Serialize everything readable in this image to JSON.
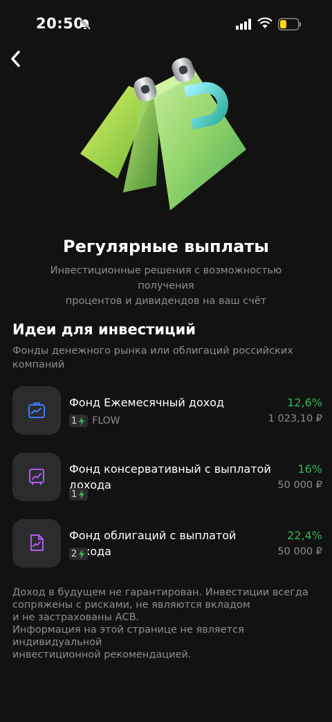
{
  "status_bar": {
    "time": "20:50"
  },
  "hero": {
    "icon": "ruble-calendar-illustration",
    "currency_symbol": "₽"
  },
  "header": {
    "title": "Регулярные выплаты",
    "subtitle_line1": "Инвестиционные решения с возможностью получения",
    "subtitle_line2": "процентов и дивидендов на ваш счёт"
  },
  "ideas": {
    "title": "Идеи для инвестиций",
    "subtitle_line1": "Фонды денежного рынка или облигаций российских",
    "subtitle_line2": "компаний",
    "funds": [
      {
        "name_line1": "Фонд Ежемесячный доход",
        "name_line2": "",
        "risk_level": "1",
        "ticker": "FLOW",
        "yield": "12,6%",
        "amount": "1 023,10 ₽",
        "icon": "briefcase-chart-icon",
        "icon_color": "#3d7dff"
      },
      {
        "name_line1": "Фонд консервативный с выплатой",
        "name_line2": "дохода",
        "risk_level": "1",
        "ticker": "",
        "yield": "16%",
        "amount": "50 000 ₽",
        "icon": "safe-chart-icon",
        "icon_color": "#b05cf0"
      },
      {
        "name_line1": "Фонд облигаций с выплатой дохода",
        "name_line2": "",
        "risk_level": "2",
        "ticker": "",
        "yield": "22,4%",
        "amount": "50 000 ₽",
        "icon": "document-chart-icon",
        "icon_color": "#b05cf0"
      }
    ]
  },
  "disclaimer": {
    "line1": "Доход в будущем не гарантирован. Инвестиции всегда",
    "line2": "сопряжены с рисками, не являются вкладом",
    "line3": "и не застрахованы АСВ.",
    "line4": "Информация на этой странице не является индивидуальной",
    "line5": "инвестиционной рекомендацией."
  },
  "colors": {
    "background": "#121212",
    "positive": "#34b758",
    "secondary_text": "#8e8e93",
    "card": "#2c2c2e"
  }
}
